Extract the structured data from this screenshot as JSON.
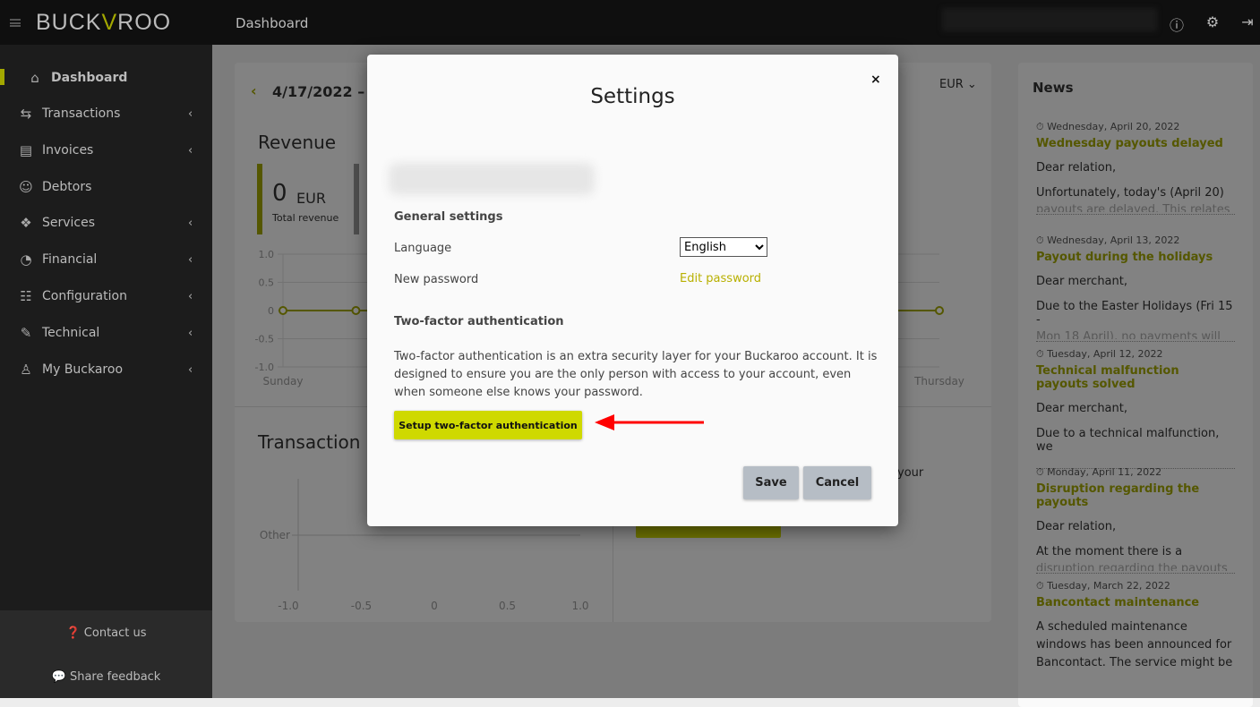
{
  "header": {
    "logo": "BUCKAROO",
    "title": "Dashboard",
    "icons": [
      "feedback-icon",
      "user-settings-icon",
      "logout-icon"
    ]
  },
  "sidebar": {
    "items": [
      {
        "label": "Dashboard",
        "icon": "home-icon",
        "active": true
      },
      {
        "label": "Transactions",
        "icon": "transfer-icon"
      },
      {
        "label": "Invoices",
        "icon": "invoices-icon"
      },
      {
        "label": "Debtors",
        "icon": "users-icon"
      },
      {
        "label": "Services",
        "icon": "services-icon"
      },
      {
        "label": "Financial",
        "icon": "piggy-bank-icon"
      },
      {
        "label": "Configuration",
        "icon": "sliders-icon"
      },
      {
        "label": "Technical",
        "icon": "wrench-icon"
      },
      {
        "label": "My Buckaroo",
        "icon": "user-icon"
      }
    ],
    "contact": "Contact us",
    "feedback": "Share feedback"
  },
  "dashboard": {
    "date_range": "4/17/2022 – 4",
    "currency": "EUR",
    "revenue_title": "Revenue",
    "total_value": "0",
    "total_currency": "EUR",
    "total_label": "Total revenue",
    "transactions_title": "Transaction",
    "partial_text": "your"
  },
  "chart_data": [
    {
      "type": "line",
      "x": [
        "Sunday",
        "Thursday"
      ],
      "yticks": [
        "1.0",
        "0.5",
        "0",
        "-0.5",
        "-1.0"
      ],
      "ylim": [
        -1,
        1
      ],
      "values": [
        0,
        0,
        0,
        0,
        0,
        0,
        0,
        0,
        0,
        0
      ],
      "color": "#a3a800",
      "grid": true
    },
    {
      "type": "bar",
      "orientation": "horizontal",
      "categories": [
        "Other"
      ],
      "xticks": [
        "-1.0",
        "-0.5",
        "0",
        "0.5",
        "1.0"
      ],
      "xlim": [
        -1,
        1
      ],
      "values": [
        0
      ]
    }
  ],
  "news": {
    "title": "News",
    "items": [
      {
        "date": "Wednesday, April 20, 2022",
        "title": "Wednesday payouts delayed",
        "p1": "Dear relation,",
        "p2": "Unfortunately, today's (April 20)",
        "p3": "payouts are delayed. This relates"
      },
      {
        "date": "Wednesday, April 13, 2022",
        "title": "Payout during the holidays",
        "p1": "Dear merchant,",
        "p2": "Due to the Easter Holidays (Fri 15 -",
        "p3": "Mon 18 April), no payments will be"
      },
      {
        "date": "Tuesday, April 12, 2022",
        "title": "Technical malfunction payouts solved",
        "p1": "Dear merchant,",
        "p2": "Due to a technical malfunction, we",
        "p3": ""
      },
      {
        "date": "Monday, April 11, 2022",
        "title": "Disruption regarding the payouts",
        "p1": "Dear relation,",
        "p2": "At the moment there is a",
        "p3": "disruption regarding the payouts"
      },
      {
        "date": "Tuesday, March 22, 2022",
        "title": "Bancontact maintenance",
        "p1": "A scheduled maintenance windows has been announced for Bancontact. The service might be",
        "p2": "",
        "p3": ""
      }
    ]
  },
  "modal": {
    "title": "Settings",
    "close": "×",
    "general": "General settings",
    "language_label": "Language",
    "language_value": "English",
    "password_label": "New password",
    "password_link": "Edit password",
    "twofa_title": "Two-factor authentication",
    "twofa_desc": "Two-factor authentication is an extra security layer for your Buckaroo account. It is designed to ensure you are the only person with access to your account, even when someone else knows your password.",
    "setup": "Setup two-factor authentication",
    "save": "Save",
    "cancel": "Cancel"
  },
  "colors": {
    "accent": "#cfd900",
    "annotation_arrow": "#ff0000"
  }
}
